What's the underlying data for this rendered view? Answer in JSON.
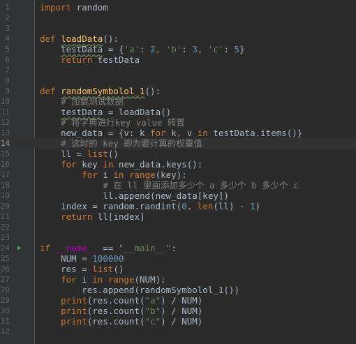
{
  "lines": [
    {
      "n": "1",
      "tokens": [
        {
          "t": "import",
          "c": "kw"
        },
        {
          "t": " random",
          "c": ""
        }
      ]
    },
    {
      "n": "2",
      "tokens": []
    },
    {
      "n": "3",
      "tokens": []
    },
    {
      "n": "4",
      "tokens": [
        {
          "t": "def ",
          "c": "kw"
        },
        {
          "t": "loadData",
          "c": "fn wavy"
        },
        {
          "t": "():",
          "c": ""
        }
      ]
    },
    {
      "n": "5",
      "tokens": [
        {
          "t": "    ",
          "c": ""
        },
        {
          "t": "testData",
          "c": "wavy"
        },
        {
          "t": " = {",
          "c": ""
        },
        {
          "t": "'a'",
          "c": "str"
        },
        {
          "t": ": ",
          "c": ""
        },
        {
          "t": "2",
          "c": "num"
        },
        {
          "t": ", ",
          "c": "kw"
        },
        {
          "t": "'b'",
          "c": "str"
        },
        {
          "t": ": ",
          "c": ""
        },
        {
          "t": "3",
          "c": "num"
        },
        {
          "t": ", ",
          "c": "kw"
        },
        {
          "t": "'c'",
          "c": "str"
        },
        {
          "t": ": ",
          "c": ""
        },
        {
          "t": "5",
          "c": "num"
        },
        {
          "t": "}",
          "c": ""
        }
      ]
    },
    {
      "n": "6",
      "tokens": [
        {
          "t": "    ",
          "c": ""
        },
        {
          "t": "return",
          "c": "kw"
        },
        {
          "t": " testData",
          "c": ""
        }
      ]
    },
    {
      "n": "7",
      "tokens": []
    },
    {
      "n": "8",
      "tokens": []
    },
    {
      "n": "9",
      "tokens": [
        {
          "t": "def ",
          "c": "kw"
        },
        {
          "t": "randomSymbolol_1",
          "c": "fn wavy"
        },
        {
          "t": "():",
          "c": ""
        }
      ]
    },
    {
      "n": "10",
      "tokens": [
        {
          "t": "    ",
          "c": ""
        },
        {
          "t": "# 加载测试数据",
          "c": "cm"
        }
      ]
    },
    {
      "n": "11",
      "tokens": [
        {
          "t": "    ",
          "c": ""
        },
        {
          "t": "testData",
          "c": "wavy"
        },
        {
          "t": " = loadData()",
          "c": ""
        }
      ]
    },
    {
      "n": "12",
      "tokens": [
        {
          "t": "    ",
          "c": ""
        },
        {
          "t": "# 将字典进行key value 转置",
          "c": "cm"
        }
      ]
    },
    {
      "n": "13",
      "tokens": [
        {
          "t": "    new_data = {v: k ",
          "c": ""
        },
        {
          "t": "for",
          "c": "kw"
        },
        {
          "t": " k",
          "c": ""
        },
        {
          "t": ",",
          "c": "kw"
        },
        {
          "t": " v ",
          "c": ""
        },
        {
          "t": "in",
          "c": "kw"
        },
        {
          "t": " testData.items()}",
          "c": ""
        }
      ]
    },
    {
      "n": "14",
      "tokens": [
        {
          "t": "    ",
          "c": ""
        },
        {
          "t": "# 这时的 key 即为要计算的权重值",
          "c": "cm"
        }
      ]
    },
    {
      "n": "15",
      "tokens": [
        {
          "t": "    ll = ",
          "c": ""
        },
        {
          "t": "list",
          "c": "kw"
        },
        {
          "t": "()",
          "c": ""
        }
      ]
    },
    {
      "n": "16",
      "tokens": [
        {
          "t": "    ",
          "c": ""
        },
        {
          "t": "for",
          "c": "kw"
        },
        {
          "t": " key ",
          "c": ""
        },
        {
          "t": "in",
          "c": "kw"
        },
        {
          "t": " new_data.keys():",
          "c": ""
        }
      ]
    },
    {
      "n": "17",
      "tokens": [
        {
          "t": "        ",
          "c": ""
        },
        {
          "t": "for",
          "c": "kw"
        },
        {
          "t": " i ",
          "c": ""
        },
        {
          "t": "in",
          "c": "kw"
        },
        {
          "t": " ",
          "c": ""
        },
        {
          "t": "range",
          "c": "kw"
        },
        {
          "t": "(key):",
          "c": ""
        }
      ]
    },
    {
      "n": "18",
      "tokens": [
        {
          "t": "            ",
          "c": ""
        },
        {
          "t": "# 在 ll 里面添加多少个 a 多少个 b 多少个 c",
          "c": "cm"
        }
      ]
    },
    {
      "n": "19",
      "tokens": [
        {
          "t": "            ll.append(new_data[key])",
          "c": ""
        }
      ]
    },
    {
      "n": "20",
      "tokens": [
        {
          "t": "    index = random.randint(",
          "c": ""
        },
        {
          "t": "0",
          "c": "num"
        },
        {
          "t": ", ",
          "c": "kw"
        },
        {
          "t": "len",
          "c": "kw"
        },
        {
          "t": "(ll) - ",
          "c": ""
        },
        {
          "t": "1",
          "c": "num"
        },
        {
          "t": ")",
          "c": ""
        }
      ]
    },
    {
      "n": "21",
      "tokens": [
        {
          "t": "    ",
          "c": ""
        },
        {
          "t": "return",
          "c": "kw"
        },
        {
          "t": " ll[index]",
          "c": ""
        }
      ]
    },
    {
      "n": "22",
      "tokens": []
    },
    {
      "n": "23",
      "tokens": []
    },
    {
      "n": "24",
      "tokens": [
        {
          "t": "if",
          "c": "kw"
        },
        {
          "t": " ",
          "c": ""
        },
        {
          "t": "__name__",
          "c": "dunder"
        },
        {
          "t": " == ",
          "c": ""
        },
        {
          "t": "\"__main__\"",
          "c": "str"
        },
        {
          "t": ":",
          "c": ""
        }
      ]
    },
    {
      "n": "25",
      "tokens": [
        {
          "t": "    NUM = ",
          "c": ""
        },
        {
          "t": "100000",
          "c": "num"
        }
      ]
    },
    {
      "n": "26",
      "tokens": [
        {
          "t": "    res = ",
          "c": ""
        },
        {
          "t": "list",
          "c": "kw"
        },
        {
          "t": "()",
          "c": ""
        }
      ]
    },
    {
      "n": "27",
      "tokens": [
        {
          "t": "    ",
          "c": ""
        },
        {
          "t": "for",
          "c": "kw"
        },
        {
          "t": " i ",
          "c": ""
        },
        {
          "t": "in",
          "c": "kw"
        },
        {
          "t": " ",
          "c": ""
        },
        {
          "t": "range",
          "c": "kw"
        },
        {
          "t": "(NUM):",
          "c": ""
        }
      ]
    },
    {
      "n": "28",
      "tokens": [
        {
          "t": "        res.append(randomSymbolol_1())",
          "c": ""
        }
      ]
    },
    {
      "n": "29",
      "tokens": [
        {
          "t": "    ",
          "c": ""
        },
        {
          "t": "print",
          "c": "kw"
        },
        {
          "t": "(res.count(",
          "c": ""
        },
        {
          "t": "\"a\"",
          "c": "str"
        },
        {
          "t": ") / NUM)",
          "c": ""
        }
      ]
    },
    {
      "n": "30",
      "tokens": [
        {
          "t": "    ",
          "c": ""
        },
        {
          "t": "print",
          "c": "kw"
        },
        {
          "t": "(res.count(",
          "c": ""
        },
        {
          "t": "\"b\"",
          "c": "str"
        },
        {
          "t": ") / NUM)",
          "c": ""
        }
      ]
    },
    {
      "n": "31",
      "tokens": [
        {
          "t": "    ",
          "c": ""
        },
        {
          "t": "print",
          "c": "kw"
        },
        {
          "t": "(res.count(",
          "c": ""
        },
        {
          "t": "\"c\"",
          "c": "str"
        },
        {
          "t": ") / NUM)",
          "c": ""
        }
      ]
    },
    {
      "n": "32",
      "tokens": []
    }
  ],
  "current_line": "14",
  "run_icon": "run-icon",
  "colors": {
    "background": "#2b2b2b",
    "gutter": "#313335",
    "keyword": "#cc7832",
    "function": "#ffc66d",
    "string": "#6a8759",
    "number": "#6897bb",
    "comment": "#808080",
    "default": "#a9b7c6"
  }
}
